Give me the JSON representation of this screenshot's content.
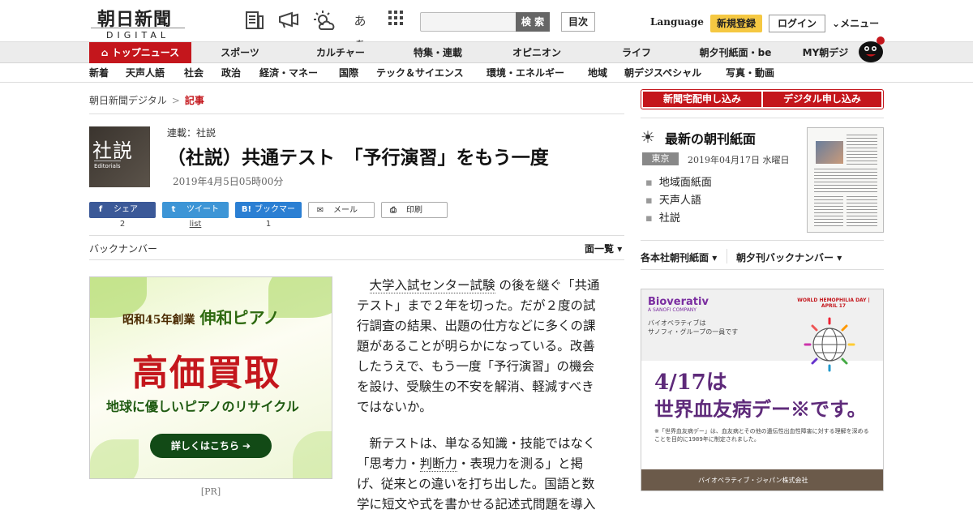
{
  "header": {
    "logo_main": "朝日新聞",
    "logo_sub": "DIGITAL",
    "icons": [
      "newspaper-icon",
      "megaphone-icon",
      "weather-icon",
      "font-size-icon",
      "apps-grid-icon"
    ],
    "font_icon_text": "あぁ",
    "search_placeholder": "",
    "search_button": "検 索",
    "contents_button": "目次",
    "language": "Language",
    "register": "新規登録",
    "login": "ログイン",
    "menu": "メニュー"
  },
  "nav_primary": [
    {
      "label": "トップニュース",
      "active": true
    },
    {
      "label": "スポーツ"
    },
    {
      "label": "カルチャー"
    },
    {
      "label": "特集・連載"
    },
    {
      "label": "オピニオン"
    },
    {
      "label": "ライフ"
    },
    {
      "label": "朝夕刊紙面・be"
    },
    {
      "label": "MY朝デジ"
    }
  ],
  "nav_secondary": [
    "新着",
    "天声人語",
    "社会",
    "政治",
    "経済・マネー",
    "国際",
    "テック＆サイエンス",
    "環境・エネルギー",
    "地域",
    "朝デジスペシャル",
    "写真・動画"
  ],
  "breadcrumb": {
    "home": "朝日新聞デジタル",
    "separator": ">",
    "current": "記事"
  },
  "article": {
    "badge_kanji": "社説",
    "badge_en": "Editorials",
    "series": "連載：社説",
    "title": "（社説）共通テスト　「予行演習」をもう一度",
    "date": "2019年4月5日05時00分",
    "share": [
      {
        "label": "シェア",
        "icon": "f",
        "count": "2"
      },
      {
        "label": "ツイート",
        "icon": "t",
        "count": "list"
      },
      {
        "label": "ブックマーク",
        "icon": "B!",
        "count": "1"
      },
      {
        "label": "メール",
        "icon": "✉"
      },
      {
        "label": "印刷",
        "icon": "⎙"
      }
    ],
    "back_number": "バックナンバー",
    "page_list": "面一覧",
    "paragraphs": [
      {
        "link": "大学入試センター試験",
        "text": " の後を継ぐ「共通テスト」まで２年を切った。だが２度の試行調査の結果、出題の仕方などに多くの課題があることが明らかになっている。改善したうえで、もう一度「予行演習」の機会を設け、受験生の不安を解消、軽減すべきではないか。"
      },
      {
        "pre": "新テストは、単なる知識・技能ではなく「思考力・",
        "link": "判断力",
        "text": "・表現力を測る」と掲げ、従来との違いを打ち出した。国語と数学に短文や式を書かせる記述式問題を導入"
      }
    ]
  },
  "ad_left": {
    "line1": "昭和45年創業",
    "line1b": "伸和ピアノ",
    "line2": "高価買取",
    "line3": "地球に優しいピアノのリサイクル",
    "button": "詳しくはこちら ➔",
    "pr": "[PR]"
  },
  "sidebar": {
    "subscribe_home": "新聞宅配申し込み",
    "subscribe_digital": "デジタル申し込み",
    "latest_title": "最新の朝刊紙面",
    "region": "東京",
    "date": "2019年04月17日 水曜日",
    "links": [
      "地域面紙面",
      "天声人語",
      "社説"
    ],
    "bottom_links": [
      "各本社朝刊紙面",
      "朝夕刊バックナンバー"
    ]
  },
  "ad_right": {
    "brand": "Bioverativ",
    "brand_sub": "A SANOFI COMPANY",
    "brand_jp": "バイオベラティブは\nサノフィ・グループの一員です",
    "headline1": "4/17は",
    "headline2": "世界血友病デー※です。",
    "note": "※「世界血友病デー」は、血友病とその他の遺伝性出血性障害に対する理解を深めることを目的に1989年に制定されました。",
    "footer": "バイオベラティブ・ジャパン株式会社　https://www.bioverativ.co.jp",
    "badge": "WORLD HEMOPHILIA DAY | APRIL 17"
  },
  "colors": {
    "brand_red": "#c4161c",
    "accent_yellow": "#f5c842",
    "purple": "#5e2a7a"
  }
}
